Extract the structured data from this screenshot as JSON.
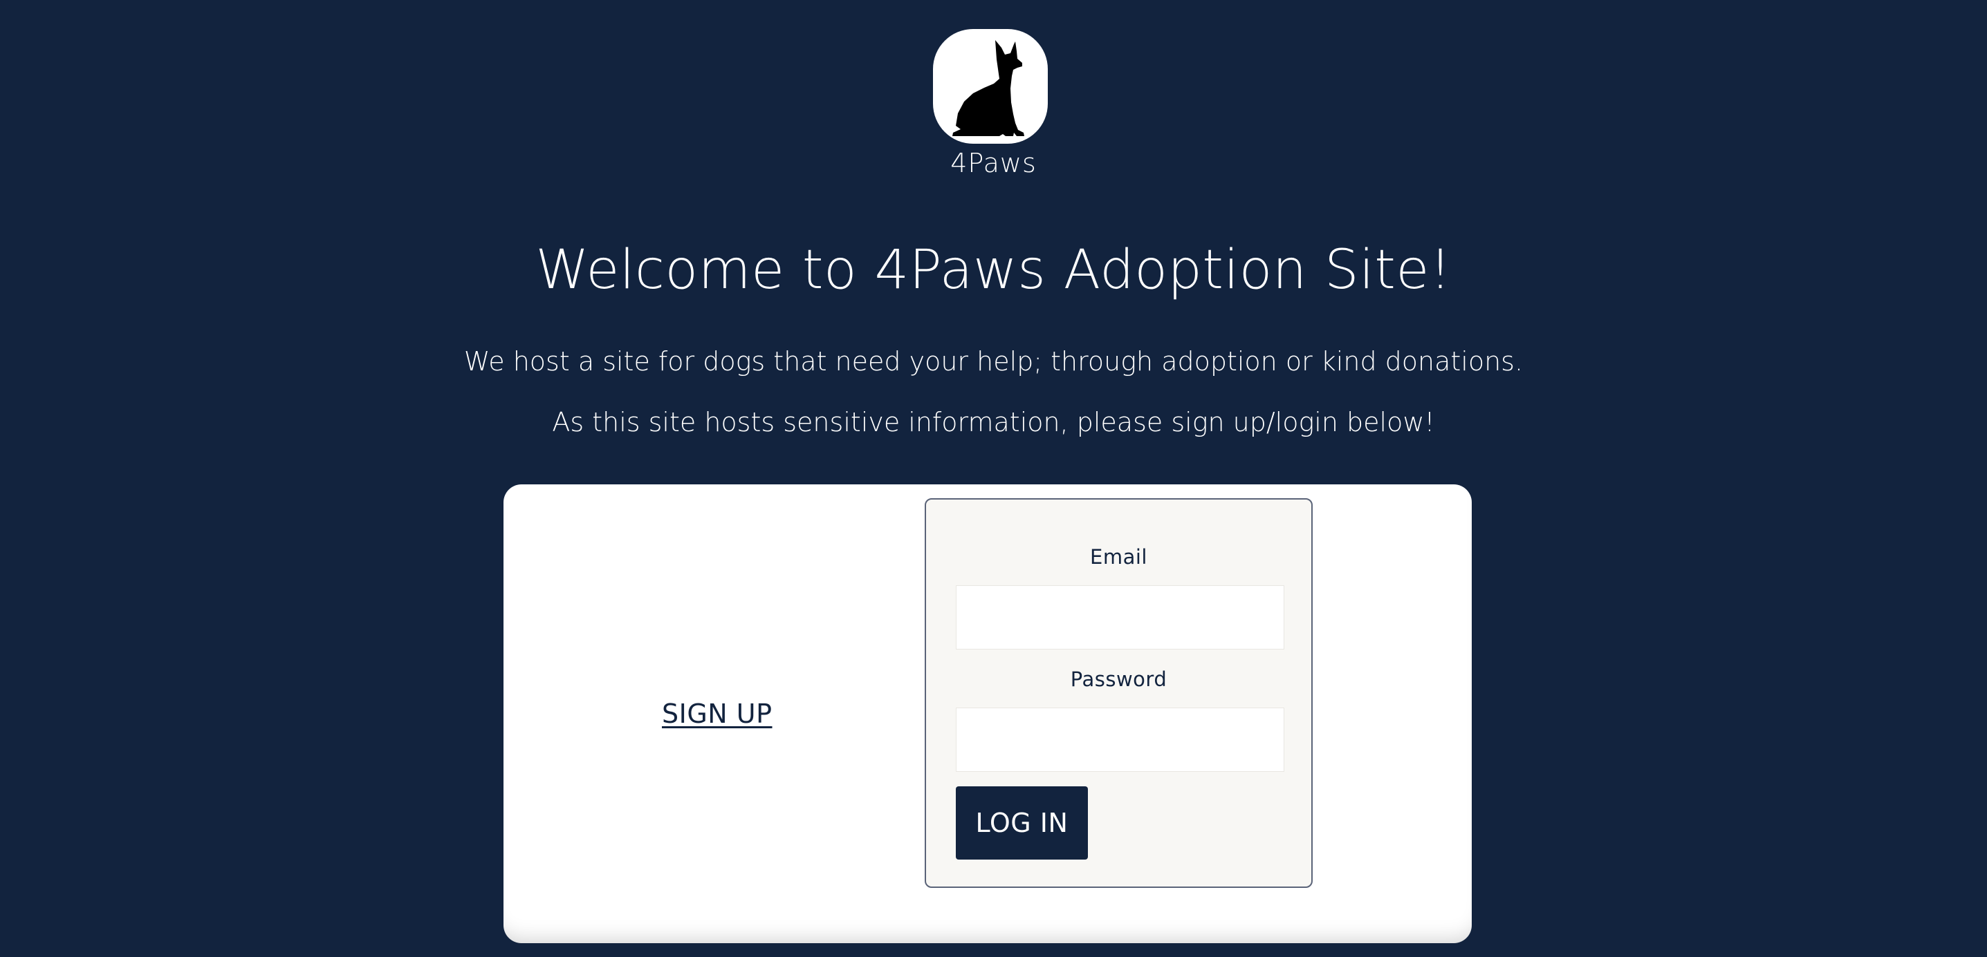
{
  "header": {
    "logo_icon": "sitting-dog-silhouette-icon",
    "brand_name": "4Paws"
  },
  "intro": {
    "title": "Welcome to 4Paws Adoption Site!",
    "line1": "We host a site for dogs that need your help; through adoption or kind donations.",
    "line2": "As this site hosts sensitive information, please sign up/login below!"
  },
  "auth": {
    "signup_label": "SIGN UP",
    "email_label": "Email",
    "email_value": "",
    "password_label": "Password",
    "password_value": "",
    "login_label": "LOG IN"
  },
  "colors": {
    "background": "#12233e",
    "card": "#ffffff",
    "panel": "#f8f7f4",
    "accent": "#12233e"
  }
}
